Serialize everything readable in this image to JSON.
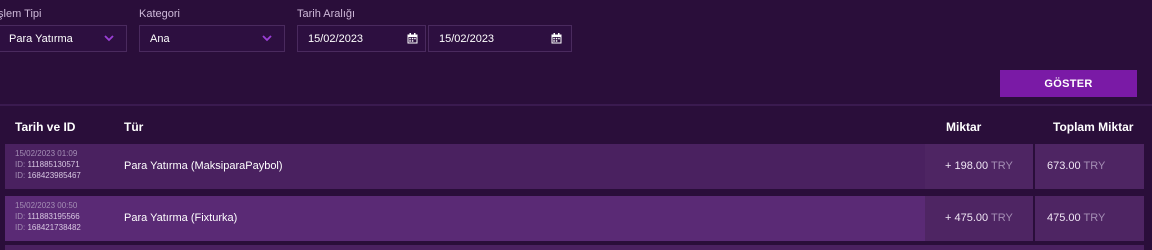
{
  "filters": {
    "islem_tipi": {
      "label": "İşlem Tipi",
      "value": "Para Yatırma"
    },
    "kategori": {
      "label": "Kategori",
      "value": "Ana"
    },
    "tarih": {
      "label": "Tarih Aralığı",
      "start": "15/02/2023",
      "end": "15/02/2023"
    },
    "button_label": "GÖSTER"
  },
  "table": {
    "headers": {
      "date_id": "Tarih ve ID",
      "type": "Tür",
      "amount": "Miktar",
      "total": "Toplam Miktar"
    },
    "rows": [
      {
        "datetime": "15/02/2023 01:09",
        "id_label_1": "ID:",
        "id1": "111885130571",
        "id_label_2": "ID:",
        "id2": "168423985467",
        "type": "Para Yatırma (MaksiparaPaybol)",
        "amount": "+ 198.00",
        "amount_currency": "TRY",
        "total": "673.00",
        "total_currency": "TRY"
      },
      {
        "datetime": "15/02/2023 00:50",
        "id_label_1": "ID:",
        "id1": "111883195566",
        "id_label_2": "ID:",
        "id2": "168421738482",
        "type": "Para Yatırma (Fixturka)",
        "amount": "+ 475.00",
        "amount_currency": "TRY",
        "total": "475.00",
        "total_currency": "TRY"
      }
    ]
  },
  "colors": {
    "background": "#2a0e3a",
    "row_1": "#4a2160",
    "row_2": "#5a2a75",
    "button": "#7a1aa6",
    "chevron": "#9b3fd6"
  }
}
